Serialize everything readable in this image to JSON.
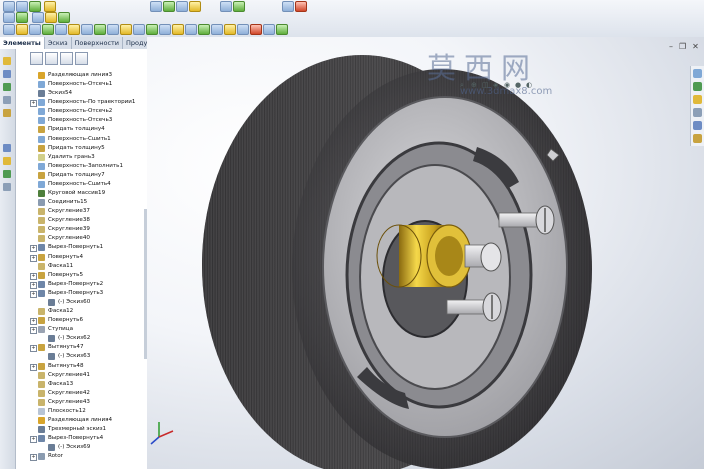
{
  "tabs": [
    "Элементы",
    "Эскиз",
    "Поверхности",
    "Продукты Office"
  ],
  "watermark": {
    "text": "莫西网",
    "url": "www.3dmax8.com"
  },
  "tree": [
    {
      "label": "Разделяющая линия3",
      "icon": "split-line-icon",
      "color": "#d9a52a",
      "exp": false
    },
    {
      "label": "Поверхность-Отсечь1",
      "icon": "surface-trim-icon",
      "color": "#7fa8d6",
      "exp": false
    },
    {
      "label": "Эскиз54",
      "icon": "sketch-icon",
      "color": "#6a7d96",
      "exp": false
    },
    {
      "label": "Поверхность-По траектории1",
      "icon": "surface-sweep-icon",
      "color": "#7fa8d6",
      "exp": true
    },
    {
      "label": "Поверхность-Отсечь2",
      "icon": "surface-trim-icon",
      "color": "#7fa8d6",
      "exp": false
    },
    {
      "label": "Поверхность-Отсечь3",
      "icon": "surface-trim-icon",
      "color": "#7fa8d6",
      "exp": false
    },
    {
      "label": "Придать толщину4",
      "icon": "thicken-icon",
      "color": "#c8a340",
      "exp": false
    },
    {
      "label": "Поверхность-Сшить1",
      "icon": "surface-knit-icon",
      "color": "#7fa8d6",
      "exp": false
    },
    {
      "label": "Придать толщину5",
      "icon": "thicken-icon",
      "color": "#c8a340",
      "exp": false
    },
    {
      "label": "Удалить грань3",
      "icon": "delete-face-icon",
      "color": "#d1cf8a",
      "exp": false
    },
    {
      "label": "Поверхность-Заполнить1",
      "icon": "surface-fill-icon",
      "color": "#7fa8d6",
      "exp": false
    },
    {
      "label": "Придать толщину7",
      "icon": "thicken-icon",
      "color": "#c8a340",
      "exp": false
    },
    {
      "label": "Поверхность-Сшить4",
      "icon": "surface-knit-icon",
      "color": "#7fa8d6",
      "exp": false
    },
    {
      "label": "Круговой массив19",
      "icon": "circular-pattern-icon",
      "color": "#4e7f3c",
      "exp": false
    },
    {
      "label": "Соединить15",
      "icon": "combine-icon",
      "color": "#8a9bb0",
      "exp": false
    },
    {
      "label": "Скругление37",
      "icon": "fillet-icon",
      "color": "#c9b46b",
      "exp": false
    },
    {
      "label": "Скругление38",
      "icon": "fillet-icon",
      "color": "#c9b46b",
      "exp": false
    },
    {
      "label": "Скругление39",
      "icon": "fillet-icon",
      "color": "#c9b46b",
      "exp": false
    },
    {
      "label": "Скругление40",
      "icon": "fillet-icon",
      "color": "#c9b46b",
      "exp": false
    },
    {
      "label": "Вырез-Повернуть1",
      "icon": "cut-revolve-icon",
      "color": "#6e86a8",
      "exp": true
    },
    {
      "label": "Повернуть4",
      "icon": "revolve-icon",
      "color": "#c8a340",
      "exp": true
    },
    {
      "label": "Фаска11",
      "icon": "chamfer-icon",
      "color": "#c9b46b",
      "exp": false
    },
    {
      "label": "Повернуть5",
      "icon": "revolve-icon",
      "color": "#c8a340",
      "exp": true
    },
    {
      "label": "Вырез-Повернуть2",
      "icon": "cut-revolve-icon",
      "color": "#6e86a8",
      "exp": true
    },
    {
      "label": "Вырез-Повернуть3",
      "icon": "cut-revolve-icon",
      "color": "#6e86a8",
      "exp": true
    },
    {
      "label": "(-) Эскиз60",
      "icon": "sketch-icon",
      "color": "#6a7d96",
      "exp": false,
      "indent": 1
    },
    {
      "label": "Фаска12",
      "icon": "chamfer-icon",
      "color": "#c9b46b",
      "exp": false
    },
    {
      "label": "Повернуть6",
      "icon": "revolve-icon",
      "color": "#c8a340",
      "exp": true
    },
    {
      "label": "Ступица",
      "icon": "hub-folder-icon",
      "color": "#9aa3b2",
      "exp": true
    },
    {
      "label": "(-) Эскиз62",
      "icon": "sketch-icon",
      "color": "#6a7d96",
      "exp": false,
      "indent": 1
    },
    {
      "label": "Вытянуть47",
      "icon": "extrude-icon",
      "color": "#c8a340",
      "exp": true
    },
    {
      "label": "(-) Эскиз63",
      "icon": "sketch-icon",
      "color": "#6a7d96",
      "exp": false,
      "indent": 1
    },
    {
      "label": "Вытянуть48",
      "icon": "extrude-icon",
      "color": "#c8a340",
      "exp": true
    },
    {
      "label": "Скругление41",
      "icon": "fillet-icon",
      "color": "#c9b46b",
      "exp": false
    },
    {
      "label": "Фаска13",
      "icon": "chamfer-icon",
      "color": "#c9b46b",
      "exp": false
    },
    {
      "label": "Скругление42",
      "icon": "fillet-icon",
      "color": "#c9b46b",
      "exp": false
    },
    {
      "label": "Скругление43",
      "icon": "fillet-icon",
      "color": "#c9b46b",
      "exp": false
    },
    {
      "label": "Плоскость12",
      "icon": "plane-icon",
      "color": "#b8c4d4",
      "exp": false
    },
    {
      "label": "Разделяющая линия4",
      "icon": "split-line-icon",
      "color": "#d9a52a",
      "exp": false
    },
    {
      "label": "Трехмерный эскиз1",
      "icon": "3d-sketch-icon",
      "color": "#6a7d96",
      "exp": false
    },
    {
      "label": "Вырез-Повернуть4",
      "icon": "cut-revolve-icon",
      "color": "#6e86a8",
      "exp": true
    },
    {
      "label": "(-) Эскиз69",
      "icon": "sketch-icon",
      "color": "#6a7d96",
      "exp": false,
      "indent": 1
    },
    {
      "label": "Rotor",
      "icon": "rotor-icon",
      "color": "#8a9bb0",
      "exp": true
    }
  ]
}
